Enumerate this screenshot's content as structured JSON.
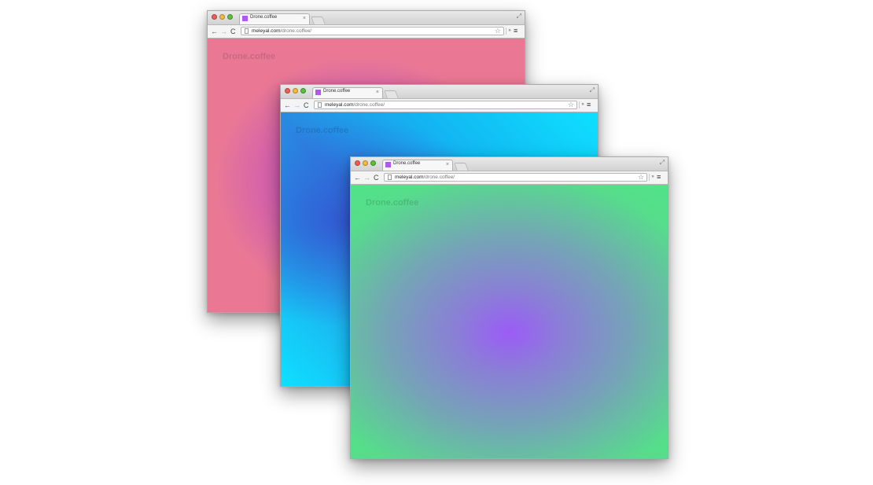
{
  "browsers": [
    {
      "id": "back",
      "tab_title": "Drone.coffee",
      "tab_close": "×",
      "url_host": "meleyal.com",
      "url_path": "/drone.coffee/",
      "page_heading": "Drone.coffee"
    },
    {
      "id": "middle",
      "tab_title": "Drone.coffee",
      "tab_close": "×",
      "url_host": "meleyal.com",
      "url_path": "/drone.coffee/",
      "page_heading": "Drone.coffee"
    },
    {
      "id": "front",
      "tab_title": "Drone.coffee",
      "tab_close": "×",
      "url_host": "meleyal.com",
      "url_path": "/drone.coffee/",
      "page_heading": "Drone.coffee"
    }
  ],
  "icons": {
    "back": "←",
    "forward": "→",
    "reload": "C",
    "star": "☆",
    "extensions": "»",
    "menu": "≡",
    "fullscreen": "⤢"
  },
  "colors": {
    "back_page": "#ea7895",
    "middle_page": "#0ee0ff",
    "front_page": "#4fe587",
    "favicon": "#b058f0"
  }
}
